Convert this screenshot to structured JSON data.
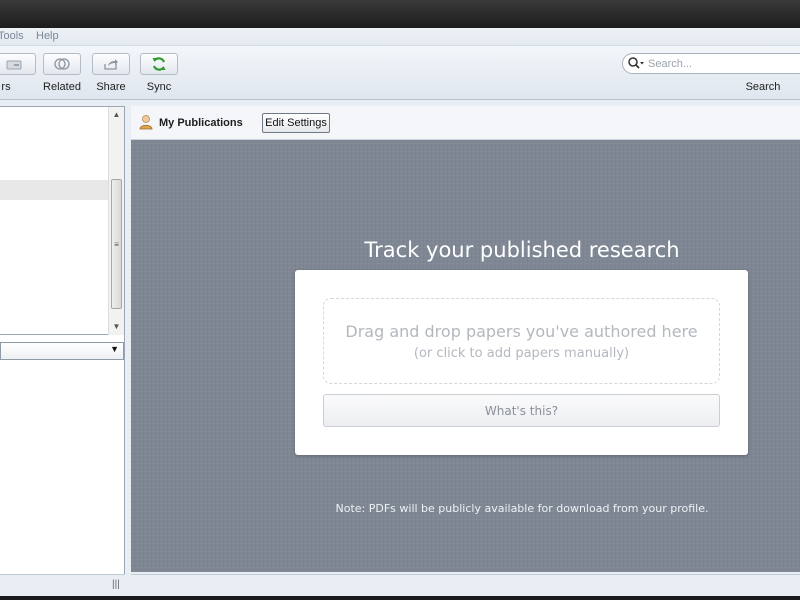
{
  "menu": {
    "items": [
      "Tools",
      "Help"
    ]
  },
  "toolbar": {
    "buttons": [
      {
        "label": "rs",
        "icon": "folder-icon"
      },
      {
        "label": "Related",
        "icon": "related-icon"
      },
      {
        "label": "Share",
        "icon": "share-icon"
      },
      {
        "label": "Sync",
        "icon": "sync-icon"
      }
    ],
    "search_placeholder": "Search...",
    "search_label": "Search"
  },
  "main": {
    "section_title": "My Publications",
    "edit_settings_label": "Edit Settings",
    "headline": "Track your published research",
    "drop_text": "Drag and drop papers you've authored here",
    "drop_subtext": "(or click to add papers manually)",
    "whats_this_label": "What's this?",
    "note": "Note: PDFs will be publicly available for download from your profile."
  },
  "colors": {
    "sync_green": "#2f9a2f",
    "main_bg": "#7f8794"
  }
}
